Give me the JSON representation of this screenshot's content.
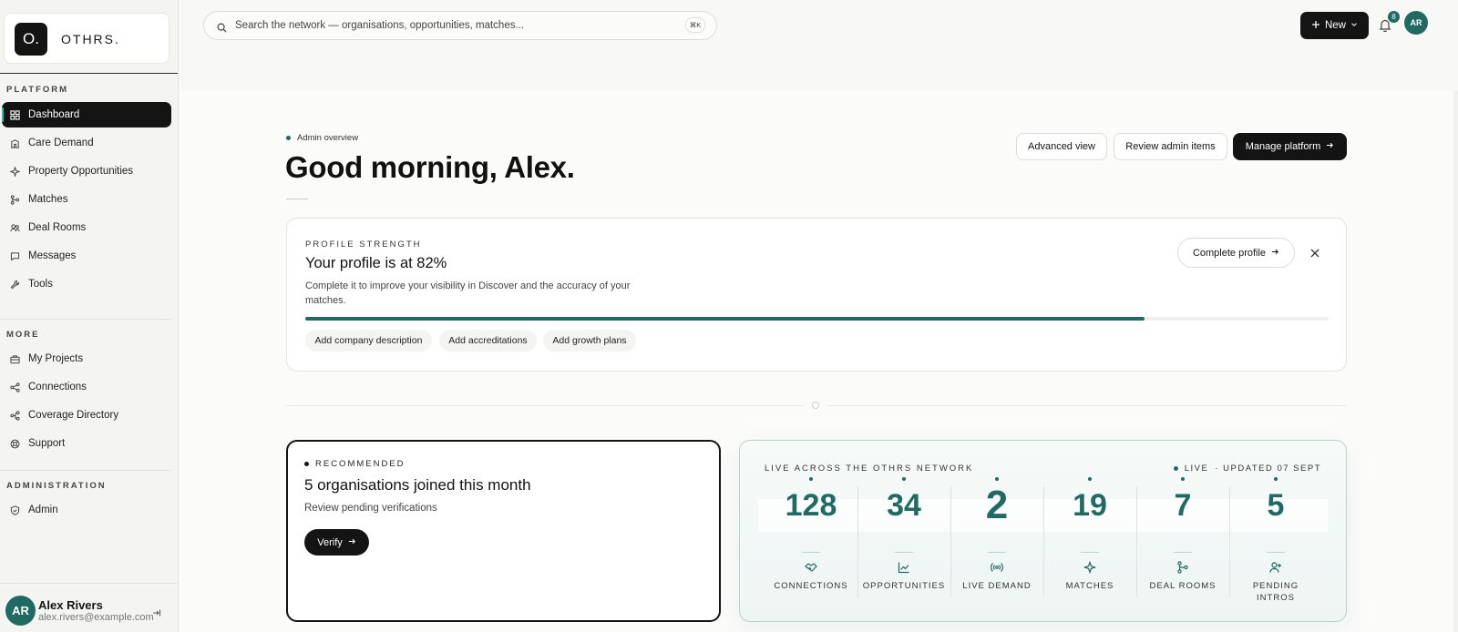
{
  "brand": {
    "logo_mark": "O.",
    "name": "OTHRS."
  },
  "sidebar": {
    "sections": [
      {
        "label": "PLATFORM",
        "items": [
          {
            "label": "Dashboard",
            "icon": "grid-icon",
            "active": true
          },
          {
            "label": "Care Demand",
            "icon": "building-icon"
          },
          {
            "label": "Property Opportunities",
            "icon": "sparkle-icon"
          },
          {
            "label": "Matches",
            "icon": "branch-icon"
          },
          {
            "label": "Deal Rooms",
            "icon": "users-icon"
          },
          {
            "label": "Messages",
            "icon": "message-icon"
          },
          {
            "label": "Tools",
            "icon": "wrench-icon"
          }
        ]
      },
      {
        "label": "MORE",
        "items": [
          {
            "label": "My Projects",
            "icon": "briefcase-icon"
          },
          {
            "label": "Connections",
            "icon": "share-icon"
          },
          {
            "label": "Coverage Directory",
            "icon": "network-icon"
          },
          {
            "label": "Support",
            "icon": "lifebuoy-icon"
          }
        ]
      },
      {
        "label": "ADMINISTRATION",
        "items": [
          {
            "label": "Admin",
            "icon": "shield-icon"
          }
        ]
      }
    ],
    "user": {
      "initials": "AR",
      "name": "Alex Rivers",
      "email": "alex.rivers@example.com"
    }
  },
  "topbar": {
    "search_placeholder": "Search the network — organisations, opportunities, matches...",
    "shortcut": "⌘K",
    "new_label": "New",
    "notification_count": "8",
    "avatar_initials": "AR"
  },
  "header": {
    "eyebrow": "Admin overview",
    "title": "Good morning, Alex.",
    "actions": {
      "advanced": "Advanced view",
      "review": "Review admin items",
      "manage": "Manage platform"
    }
  },
  "profile": {
    "eyebrow": "PROFILE STRENGTH",
    "title": "Your profile is at 82%",
    "description": "Complete it to improve your visibility in Discover and the accuracy of your matches.",
    "progress_percent": 82,
    "complete_label": "Complete profile",
    "chips": [
      "Add company description",
      "Add accreditations",
      "Add growth plans"
    ]
  },
  "recommended": {
    "eyebrow": "RECOMMENDED",
    "title": "5 organisations joined this month",
    "subtitle": "Review pending verifications",
    "button": "Verify"
  },
  "live": {
    "eyebrow": "LIVE ACROSS THE OTHRS NETWORK",
    "status": "LIVE",
    "updated": "· UPDATED 07 SEPT",
    "stats": [
      {
        "value": "128",
        "label": "CONNECTIONS",
        "icon": "handshake-icon"
      },
      {
        "value": "34",
        "label": "OPPORTUNITIES",
        "icon": "trend-icon"
      },
      {
        "value": "2",
        "label": "LIVE DEMAND",
        "icon": "broadcast-icon"
      },
      {
        "value": "19",
        "label": "MATCHES",
        "icon": "sparkle-icon"
      },
      {
        "value": "7",
        "label": "DEAL ROOMS",
        "icon": "branch-icon"
      },
      {
        "value": "5",
        "label": "PENDING INTROS",
        "icon": "user-plus-icon"
      }
    ]
  },
  "colors": {
    "accent": "#1f6b63",
    "dark": "#141414",
    "sidebar_bg": "#f4f4f2"
  }
}
